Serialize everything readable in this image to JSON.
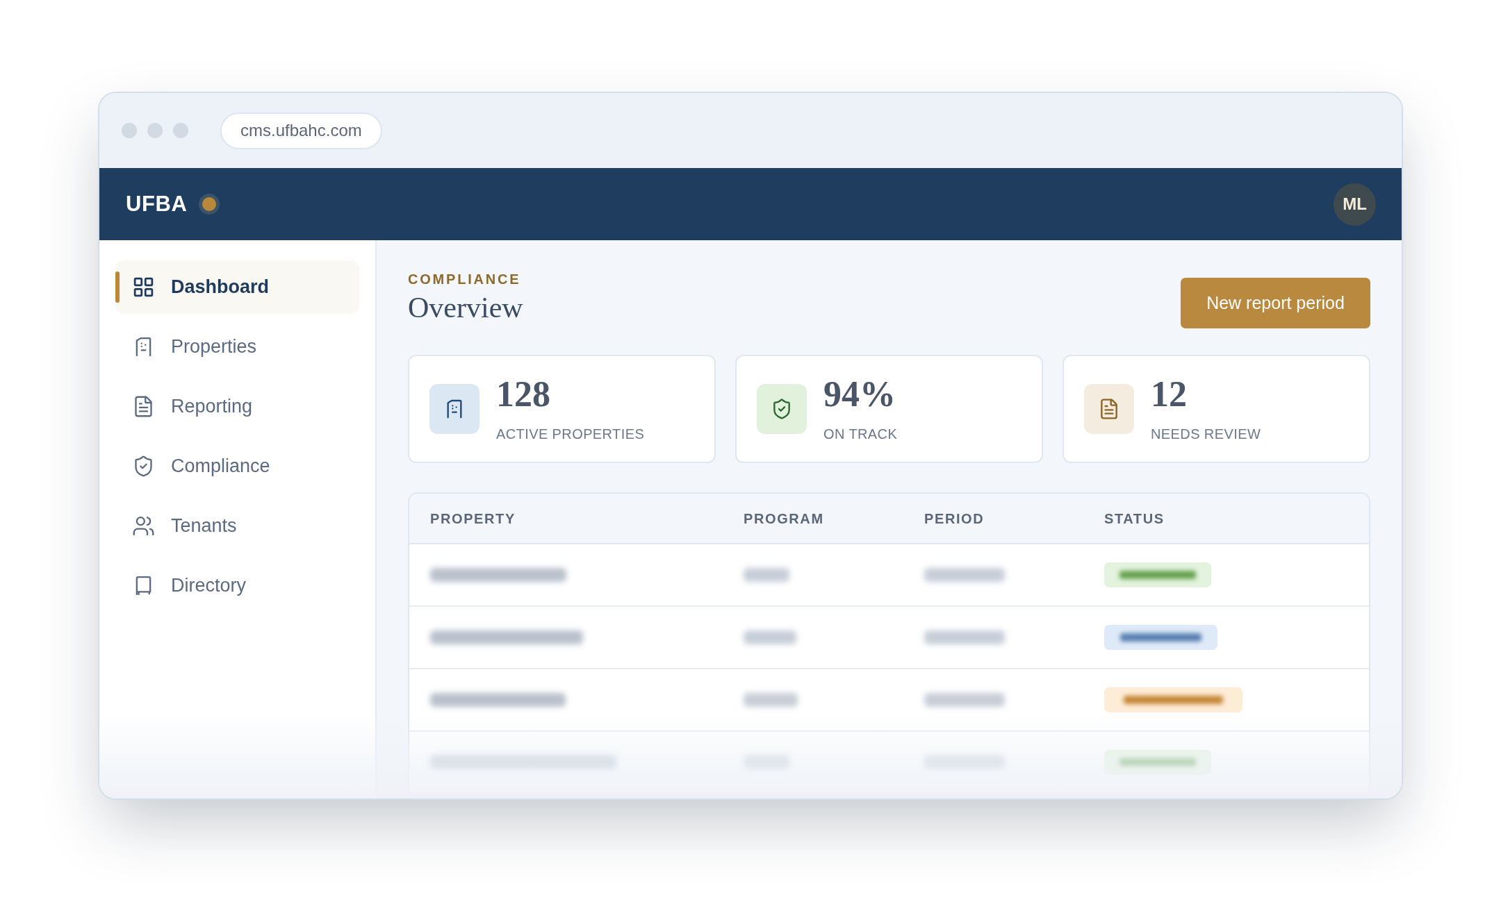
{
  "browser": {
    "url": "cms.ufbahc.com"
  },
  "header": {
    "brand": "UFBA",
    "avatar": "ML"
  },
  "sidebar": {
    "items": [
      {
        "label": "Dashboard",
        "selected": true
      },
      {
        "label": "Properties",
        "selected": false
      },
      {
        "label": "Reporting",
        "selected": false
      },
      {
        "label": "Compliance",
        "selected": false
      },
      {
        "label": "Tenants",
        "selected": false
      },
      {
        "label": "Directory",
        "selected": false
      }
    ]
  },
  "page": {
    "eyebrow": "COMPLIANCE",
    "title": "Overview",
    "button": "New report period"
  },
  "stats": [
    {
      "value": "128",
      "label": "ACTIVE PROPERTIES"
    },
    {
      "value": "94%",
      "label": "ON TRACK"
    },
    {
      "value": "12",
      "label": "NEEDS REVIEW"
    }
  ],
  "table": {
    "columns": [
      "PROPERTY",
      "PROGRAM",
      "PERIOD",
      "STATUS"
    ],
    "rows": [
      {
        "color": "#e3f3dd"
      },
      {
        "color": "#dfeaf8"
      },
      {
        "color": "#fdecd6"
      },
      {
        "color": "#e3f3dd"
      }
    ]
  }
}
